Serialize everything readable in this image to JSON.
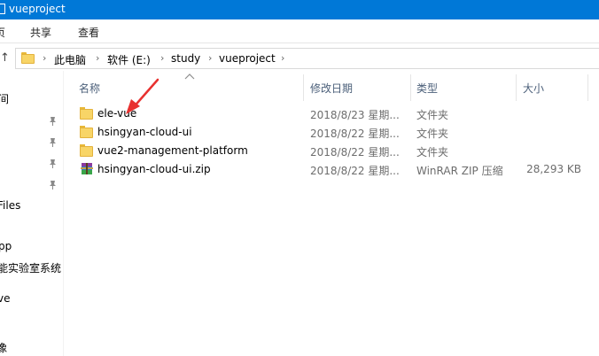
{
  "window": {
    "title": "vueproject"
  },
  "ribbon": {
    "tabs": [
      "页",
      "共享",
      "查看"
    ]
  },
  "address": {
    "crumbs": [
      "此电脑",
      "软件 (E:)",
      "study",
      "vueproject"
    ],
    "separator": "›"
  },
  "nav": {
    "items": [
      "间",
      "Files",
      "pp",
      "能实验室系统",
      "ve",
      "像"
    ]
  },
  "columns": {
    "name": "名称",
    "date": "修改日期",
    "type": "类型",
    "size": "大小"
  },
  "files": [
    {
      "name": "ele-vue",
      "date": "2018/8/23 星期...",
      "type": "文件夹",
      "size": "",
      "icon": "folder-icon"
    },
    {
      "name": "hsingyan-cloud-ui",
      "date": "2018/8/22 星期...",
      "type": "文件夹",
      "size": "",
      "icon": "folder-icon"
    },
    {
      "name": "vue2-management-platform",
      "date": "2018/8/22 星期...",
      "type": "文件夹",
      "size": "",
      "icon": "folder-icon"
    },
    {
      "name": "hsingyan-cloud-ui.zip",
      "date": "2018/8/22 星期...",
      "type": "WinRAR ZIP 压缩",
      "size": "28,293 KB",
      "icon": "winrar-archive-icon"
    }
  ],
  "colors": {
    "titlebar": "#0078d7",
    "folder": "#f8d567",
    "annotation_arrow": "#e8312f",
    "header_text": "#4c607a"
  }
}
